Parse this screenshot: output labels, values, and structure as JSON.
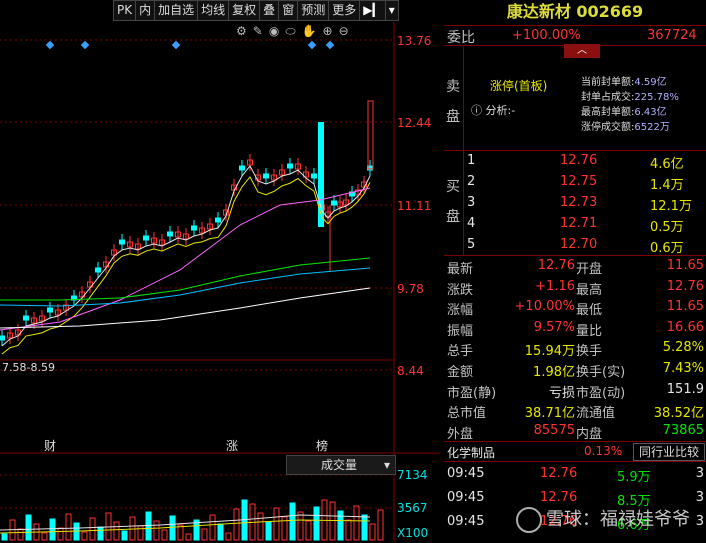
{
  "toolbar": {
    "items": [
      "PK",
      "内",
      "加自选",
      "均线",
      "复权",
      "叠",
      "窗",
      "预测",
      "更多"
    ]
  },
  "chart": {
    "price_ticks": [
      "13.76",
      "12.44",
      "11.11",
      "9.78",
      "8.44"
    ],
    "vol_ticks": [
      "7134",
      "3567",
      "X100"
    ],
    "range_label": "7.58-8.59",
    "markers": [
      "财",
      "涨",
      "榜"
    ],
    "volume_selector": "成交量",
    "colors": {
      "up": "#ff3232",
      "down": "#00ffff",
      "ma5": "#e6e6e6",
      "ma10": "#e6e600",
      "ma20": "#ff66ff",
      "ma60": "#00e600",
      "grid": "#800000"
    }
  },
  "quote": {
    "title": "康达新材 002669",
    "weibi_label": "委比",
    "weibi_pct": "+100.00%",
    "weibi_num": "367724",
    "sell_label": [
      "卖",
      "盘"
    ],
    "limit_tag": "涨停(首板)",
    "analysis_label": "分析:",
    "analysis_value": "-",
    "seal": [
      {
        "label": "当前封单额:",
        "value": "4.59亿"
      },
      {
        "label": "封单占成交:",
        "value": "225.78%"
      },
      {
        "label": "最高封单额:",
        "value": "6.43亿"
      },
      {
        "label": "涨停成交额:",
        "value": "6522万"
      }
    ],
    "buy_label": [
      "买",
      "盘"
    ],
    "bids": [
      {
        "level": "1",
        "price": "12.76",
        "vol": "4.6亿"
      },
      {
        "level": "2",
        "price": "12.75",
        "vol": "1.4万"
      },
      {
        "level": "3",
        "price": "12.73",
        "vol": "12.1万"
      },
      {
        "level": "4",
        "price": "12.71",
        "vol": "0.5万"
      },
      {
        "level": "5",
        "price": "12.70",
        "vol": "0.6万"
      }
    ],
    "stats": [
      {
        "l1": "最新",
        "v1": "12.76",
        "c1": "red",
        "l2": "开盘",
        "v2": "11.65",
        "c2": "red"
      },
      {
        "l1": "涨跌",
        "v1": "+1.16",
        "c1": "red",
        "l2": "最高",
        "v2": "12.76",
        "c2": "red"
      },
      {
        "l1": "涨幅",
        "v1": "+10.00%",
        "c1": "red",
        "l2": "最低",
        "v2": "11.65",
        "c2": "red"
      },
      {
        "l1": "振幅",
        "v1": "9.57%",
        "c1": "red",
        "l2": "量比",
        "v2": "16.66",
        "c2": "red"
      },
      {
        "l1": "总手",
        "v1": "15.94万",
        "c1": "yel",
        "l2": "换手",
        "v2": "5.28%",
        "c2": "yel"
      },
      {
        "l1": "金额",
        "v1": "1.98亿",
        "c1": "yel",
        "l2": "换手(实)",
        "v2": "7.43%",
        "c2": "yel"
      },
      {
        "l1": "市盈(静)",
        "v1": "亏损",
        "c1": "wht",
        "l2": "市盈(动)",
        "v2": "151.9",
        "c2": "wht"
      },
      {
        "l1": "总市值",
        "v1": "38.71亿",
        "c1": "yel",
        "l2": "流通值",
        "v2": "38.52亿",
        "c2": "yel"
      },
      {
        "l1": "外盘",
        "v1": "85575",
        "c1": "red",
        "l2": "内盘",
        "v2": "73865",
        "c2": "grn"
      }
    ],
    "industry": {
      "name": "化学制品",
      "pct": "0.13%",
      "compare": "同行业比较"
    },
    "ticks": [
      {
        "time": "09:45",
        "price": "12.76",
        "vol": "5.9万",
        "n": "3"
      },
      {
        "time": "09:45",
        "price": "12.76",
        "vol": "8.5万",
        "n": "3"
      },
      {
        "time": "09:45",
        "price": "12.76",
        "vol": "6.6万",
        "n": "3"
      }
    ],
    "watermark": "雪球：福禄娃爷爷"
  }
}
